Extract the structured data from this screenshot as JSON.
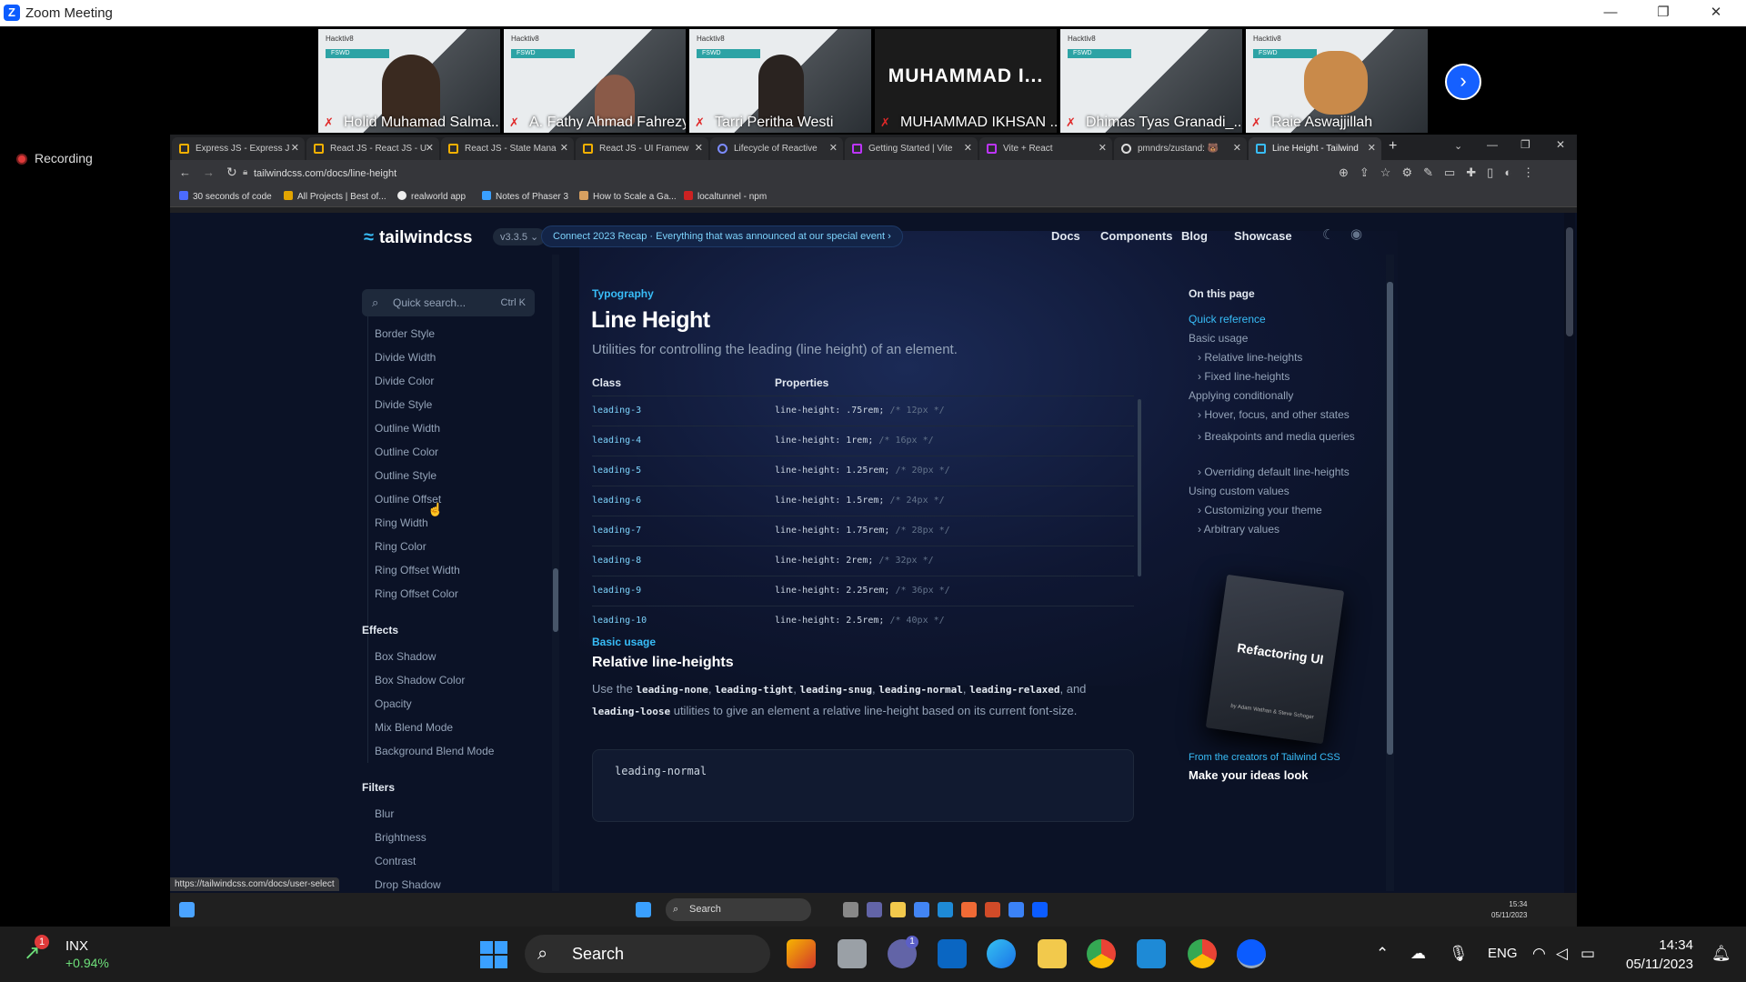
{
  "window": {
    "title": "Zoom Meeting",
    "minimize": "—",
    "restore": "❐",
    "close": "✕"
  },
  "participants": [
    {
      "name": "Holid Muhamad Salma...",
      "logo": "Hacktiv8",
      "cohort": "FSWD"
    },
    {
      "name": "A. Fathy Ahmad Fahrezy",
      "logo": "Hacktiv8",
      "cohort": "FSWD"
    },
    {
      "name": "Tarri Peritha Westi",
      "logo": "Hacktiv8",
      "cohort": "FSWD"
    },
    {
      "name": "MUHAMMAD IKHSAN ...",
      "initials": "MUHAMMAD I..."
    },
    {
      "name": "Dhimas Tyas Granadi_...",
      "logo": "Hacktiv8",
      "cohort": "FSWD"
    },
    {
      "name": "Raie Aswajjillah",
      "logo": "Hacktiv8",
      "cohort": "FSWD"
    }
  ],
  "recording": "Recording",
  "browser": {
    "tabs": [
      {
        "label": "Express JS - Express J"
      },
      {
        "label": "React JS - React JS - U"
      },
      {
        "label": "React JS - State Mana"
      },
      {
        "label": "React JS - UI Framew"
      },
      {
        "label": "Lifecycle of Reactive"
      },
      {
        "label": "Getting Started | Vite"
      },
      {
        "label": "Vite + React"
      },
      {
        "label": "pmndrs/zustand: 🐻"
      },
      {
        "label": "Line Height - Tailwind"
      }
    ],
    "url": "tailwindcss.com/docs/line-height",
    "bookmarks": [
      "30 seconds of code",
      "All Projects | Best of...",
      "realworld app",
      "Notes of Phaser 3",
      "How to Scale a Ga...",
      "localtunnel - npm"
    ],
    "status_url": "https://tailwindcss.com/docs/user-select"
  },
  "site": {
    "logo": "tailwindcss",
    "version": "v3.3.5",
    "recap_banner": "Connect 2023 Recap  ·  Everything that was announced at our special event  ›",
    "nav": [
      "Docs",
      "Components",
      "Blog",
      "Showcase"
    ],
    "search_placeholder": "Quick search...",
    "search_shortcut": "Ctrl K"
  },
  "sidebar": {
    "items_top": [
      "Border Style",
      "Divide Width",
      "Divide Color",
      "Divide Style",
      "Outline Width",
      "Outline Color",
      "Outline Style",
      "Outline Offset",
      "Ring Width",
      "Ring Color",
      "Ring Offset Width",
      "Ring Offset Color"
    ],
    "effects_header": "Effects",
    "effects": [
      "Box Shadow",
      "Box Shadow Color",
      "Opacity",
      "Mix Blend Mode",
      "Background Blend Mode"
    ],
    "filters_header": "Filters",
    "filters": [
      "Blur",
      "Brightness",
      "Contrast",
      "Drop Shadow"
    ]
  },
  "main": {
    "eyebrow": "Typography",
    "title": "Line Height",
    "lead": "Utilities for controlling the leading (line height) of an element.",
    "table_headers": {
      "class": "Class",
      "properties": "Properties"
    },
    "rows": [
      {
        "cls": "leading-3",
        "prop": "line-height: .75rem;",
        "comment": "/* 12px */"
      },
      {
        "cls": "leading-4",
        "prop": "line-height: 1rem;",
        "comment": "/* 16px */"
      },
      {
        "cls": "leading-5",
        "prop": "line-height: 1.25rem;",
        "comment": "/* 20px */"
      },
      {
        "cls": "leading-6",
        "prop": "line-height: 1.5rem;",
        "comment": "/* 24px */"
      },
      {
        "cls": "leading-7",
        "prop": "line-height: 1.75rem;",
        "comment": "/* 28px */"
      },
      {
        "cls": "leading-8",
        "prop": "line-height: 2rem;",
        "comment": "/* 32px */"
      },
      {
        "cls": "leading-9",
        "prop": "line-height: 2.25rem;",
        "comment": "/* 36px */"
      },
      {
        "cls": "leading-10",
        "prop": "line-height: 2.5rem;",
        "comment": "/* 40px */"
      }
    ],
    "section_eyebrow": "Basic usage",
    "section_title": "Relative line-heights",
    "para_use": "Use the",
    "para_codes": [
      "leading-none",
      "leading-tight",
      "leading-snug",
      "leading-normal",
      "leading-relaxed",
      "leading-loose"
    ],
    "para_and": ", and",
    "para_end": "utilities to give an element a relative line-height based on its current font-size.",
    "code_label": "leading-normal"
  },
  "on_this_page": {
    "title": "On this page",
    "items": [
      {
        "label": "Quick reference",
        "level": 0
      },
      {
        "label": "Basic usage",
        "level": 0
      },
      {
        "label": "Relative line-heights",
        "level": 1
      },
      {
        "label": "Fixed line-heights",
        "level": 1
      },
      {
        "label": "Applying conditionally",
        "level": 0
      },
      {
        "label": "Hover, focus, and other states",
        "level": 1
      },
      {
        "label": "Breakpoints and media queries",
        "level": 1
      },
      {
        "label": "Overriding default line-heights",
        "level": 1
      },
      {
        "label": "Using custom values",
        "level": 0
      },
      {
        "label": "Customizing your theme",
        "level": 1
      },
      {
        "label": "Arbitrary values",
        "level": 1
      }
    ]
  },
  "promo": {
    "book_title": "Refactoring UI",
    "book_authors": "by Adam Wathan & Steve Schoger",
    "from": "From the creators of Tailwind CSS",
    "headline": "Make your ideas look"
  },
  "inner_taskbar": {
    "search": "Search",
    "time": "15:34",
    "date": "05/11/2023"
  },
  "taskbar": {
    "ticker": "INX",
    "ticker_change": "+0.94%",
    "ticker_badge": "1",
    "search": "Search",
    "lang": "ENG",
    "time": "14:34",
    "date": "05/11/2023",
    "teams_badge": "1"
  },
  "colors": {
    "accent": "#38bdf8",
    "zoom_blue": "#0b5cff",
    "page_bg": "#0b1226"
  }
}
